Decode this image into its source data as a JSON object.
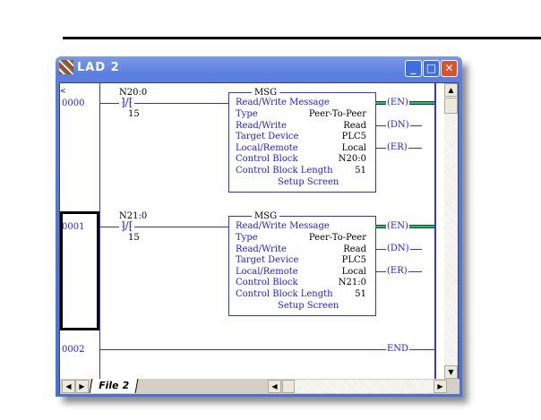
{
  "window": {
    "title": "LAD 2",
    "minimize": "_",
    "maximize": "□",
    "close": "✕"
  },
  "tabs": {
    "active": "File 2"
  },
  "rungs": [
    {
      "number": "0000",
      "contact_address": "N20:0",
      "contact_bit": "15",
      "msg": {
        "title": "MSG",
        "heading": "Read/Write Message",
        "rows": [
          [
            "Type",
            "Peer-To-Peer"
          ],
          [
            "Read/Write",
            "Read"
          ],
          [
            "Target Device",
            "PLC5"
          ],
          [
            "Local/Remote",
            "Local"
          ],
          [
            "Control Block",
            "N20:0"
          ],
          [
            "Control Block Length",
            "51"
          ]
        ],
        "setup": "Setup Screen"
      },
      "coils": [
        "EN",
        "DN",
        "ER"
      ],
      "energized": "EN"
    },
    {
      "number": "0001",
      "contact_address": "N21:0",
      "contact_bit": "15",
      "msg": {
        "title": "MSG",
        "heading": "Read/Write Message",
        "rows": [
          [
            "Type",
            "Peer-To-Peer"
          ],
          [
            "Read/Write",
            "Read"
          ],
          [
            "Target Device",
            "PLC5"
          ],
          [
            "Local/Remote",
            "Local"
          ],
          [
            "Control Block",
            "N21:0"
          ],
          [
            "Control Block Length",
            "51"
          ]
        ],
        "setup": "Setup Screen"
      },
      "coils": [
        "EN",
        "DN",
        "ER"
      ],
      "energized": "EN"
    },
    {
      "number": "0002",
      "end": "END"
    }
  ],
  "colors": {
    "wire": "#3030ff",
    "energized": "#1ed01e"
  }
}
